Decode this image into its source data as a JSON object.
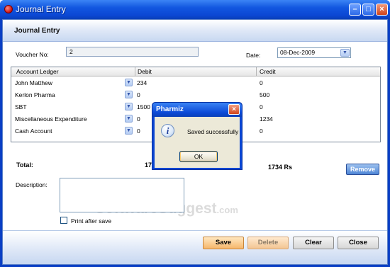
{
  "window": {
    "title": "Journal Entry",
    "controls": [
      "minimize-icon",
      "maximize-icon",
      "close-icon"
    ]
  },
  "form": {
    "header_title": "Journal Entry",
    "voucher_label": "Voucher No:",
    "voucher_value": "2",
    "date_label": "Date:",
    "date_value": "08-Dec-2009"
  },
  "grid": {
    "columns": [
      "Account Ledger",
      "Debit",
      "Credit"
    ],
    "rows": [
      {
        "ledger": "John Matthew",
        "debit": "234",
        "credit": "0"
      },
      {
        "ledger": "Kerlon Pharma",
        "debit": "0",
        "credit": "500"
      },
      {
        "ledger": "SBT",
        "debit": "1500",
        "credit": "0"
      },
      {
        "ledger": "Miscellaneous Expenditure",
        "debit": "0",
        "credit": "1234"
      },
      {
        "ledger": "Cash Account",
        "debit": "0",
        "credit": "0"
      }
    ]
  },
  "totals": {
    "label": "Total:",
    "debit": "17",
    "credit": "1734 Rs"
  },
  "remove_label": "Remove",
  "description_label": "Description:",
  "print_label": "Print after save",
  "buttons": {
    "save": "Save",
    "delete": "Delete",
    "clear": "Clear",
    "close": "Close"
  },
  "dialog": {
    "title": "Pharmiz",
    "message": "Saved successfully",
    "ok": "OK",
    "icon": "info-icon"
  },
  "watermark": {
    "main": "SoftwareSuggest",
    "suffix": ".com"
  },
  "colors": {
    "titlebar": "#0b47d4",
    "accent_orange": "#f6b66b",
    "remove_blue": "#4e86d6"
  }
}
